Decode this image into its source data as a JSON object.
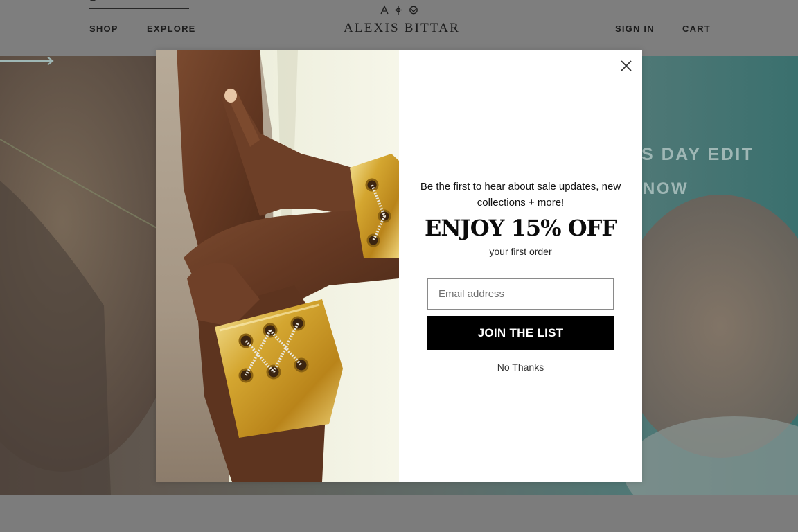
{
  "header": {
    "nav_left": [
      "SHOP",
      "EXPLORE"
    ],
    "brand": "ALEXIS BITTAR",
    "nav_right": [
      "SIGN IN",
      "CART"
    ]
  },
  "hero": {
    "headline_fragment": "S DAY EDIT",
    "cta_fragment": "NOW"
  },
  "modal": {
    "tagline": "Be the first to hear about sale updates, new collections + more!",
    "offer_title": "ENJOY 15% OFF",
    "offer_subtitle": "your first order",
    "email_placeholder": "Email address",
    "email_value": "",
    "submit_label": "JOIN THE LIST",
    "dismiss_label": "No Thanks"
  },
  "icons": [
    "search-icon",
    "brand-emblem-icon",
    "close-icon",
    "arrow-right-icon"
  ],
  "colors": {
    "overlay_dim": "#7c7c7c",
    "hero_teal": "#5c8886",
    "button_black": "#000000",
    "modal_background": "#ffffff"
  }
}
